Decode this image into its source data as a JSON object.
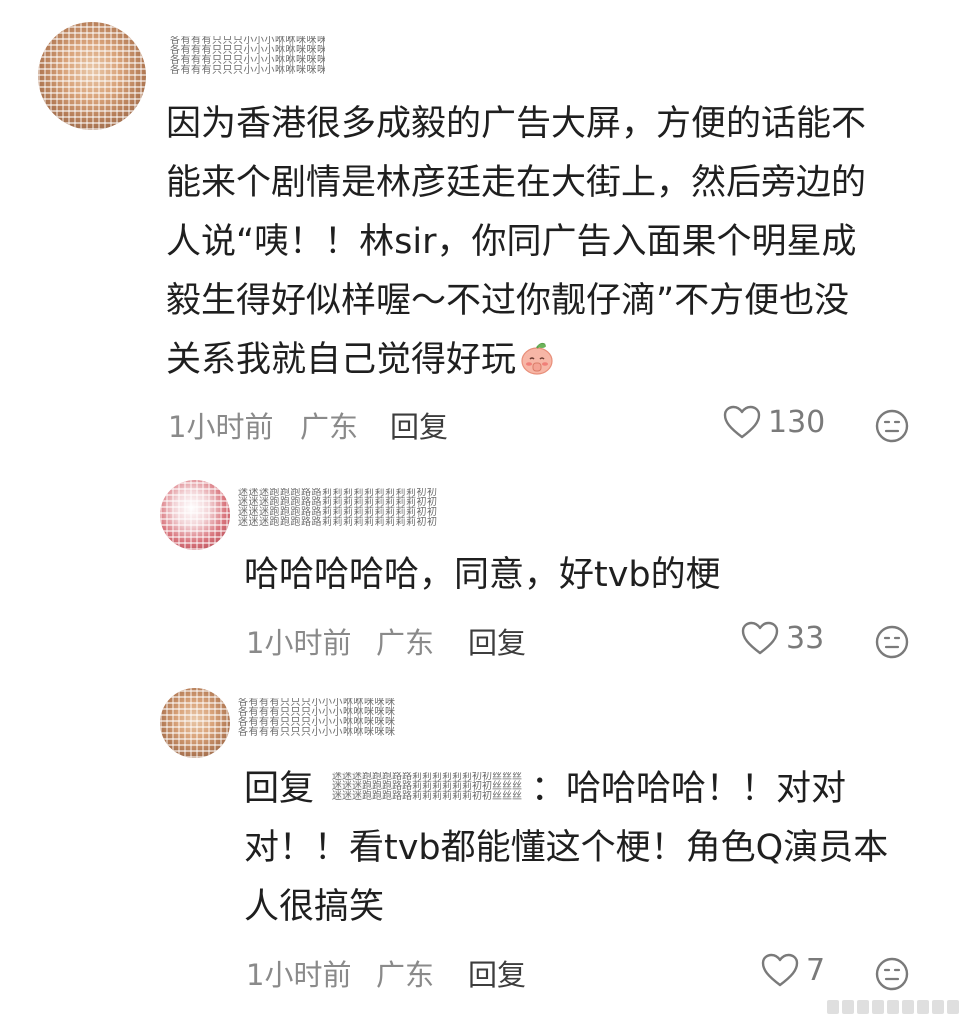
{
  "comments": [
    {
      "username_lines": [
        "各有有有只只只小小小咻咻咪咪咪",
        "各有有有只只只小小小咻咻咪咪咪",
        "各有有有只只只小小小咻咻咪咪咪",
        "各有有有只只只小小小咻咻咪咪咪"
      ],
      "text_lines": [
        "因为香港很多成毅的广告大屏，方便的话能不",
        "能来个剧情是林彦廷走在大街上，然后旁边的",
        "人说“咦！！林sir，你同广告入面果个明星成",
        "毅生得好似样喔～不过你靓仔滴”不方便也没",
        "关系我就自己觉得好玩"
      ],
      "emoji": "shy-peach-emoji",
      "time": "1小时前",
      "location": "广东",
      "reply_label": "回复",
      "like_count": "130"
    },
    {
      "username_lines": [
        "迷迷迷跑跑跑路路莉莉莉莉莉莉莉莉莉初初丝丝丝",
        "迷迷迷跑跑跑路路莉莉莉莉莉莉莉莉莉初初丝丝丝",
        "迷迷迷跑跑跑路路莉莉莉莉莉莉莉莉莉初初丝丝丝",
        "迷迷迷跑跑跑路路莉莉莉莉莉莉莉莉莉初初丝丝丝"
      ],
      "text_lines": [
        "哈哈哈哈哈，同意，好tvb的梗"
      ],
      "time": "1小时前",
      "location": "广东",
      "reply_label": "回复",
      "like_count": "33"
    },
    {
      "username_lines": [
        "各有有有只只只小小小咻咻咪咪咪",
        "各有有有只只只小小小咻咻咪咪咪",
        "各有有有只只只小小小咻咻咪咪咪",
        "各有有有只只只小小小咻咻咪咪咪"
      ],
      "reply_prefix": "回复",
      "mention_lines": [
        "迷迷迷跑跑跑路路莉莉莉莉莉莉初初丝丝丝",
        "迷迷迷跑跑跑路路莉莉莉莉莉莉初初丝丝丝",
        "迷迷迷跑跑跑路路莉莉莉莉莉莉初初丝丝丝"
      ],
      "text_first": "：哈哈哈哈！！对对",
      "text_lines": [
        "对！！看tvb都能懂这个梗！角色Q演员本",
        "人很搞笑"
      ],
      "time": "1小时前",
      "location": "广东",
      "reply_label": "回复",
      "like_count": "7"
    }
  ],
  "icons": {
    "like": "heart-outline-icon",
    "dislike": "frown-face-icon"
  },
  "colors": {
    "text": "#1f1f1f",
    "meta": "#8a8a8a",
    "reply": "#3d3d3d",
    "icon": "#7a7a7a"
  }
}
